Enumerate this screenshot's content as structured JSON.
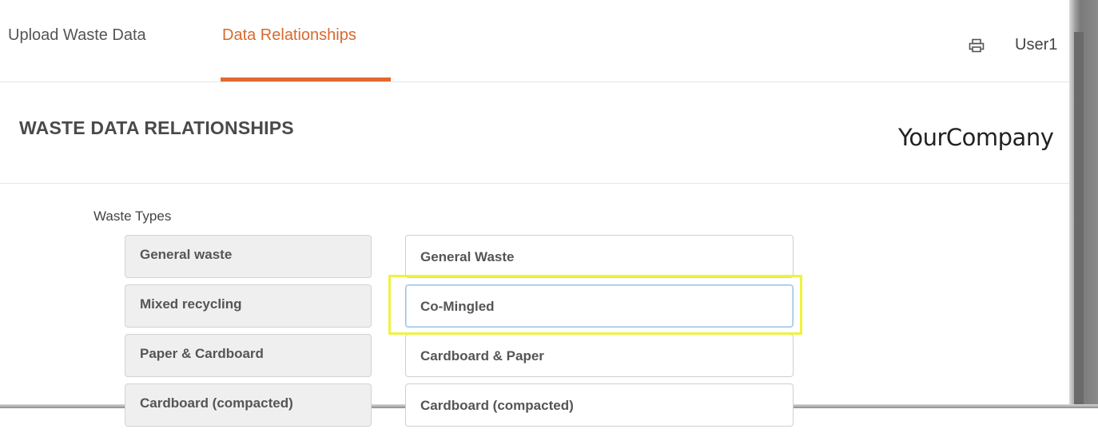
{
  "nav": {
    "tabs": [
      {
        "label": "Upload Waste Data",
        "active": false
      },
      {
        "label": "Data Relationships",
        "active": true
      }
    ],
    "user": "User1",
    "accent_color": "#e0692f"
  },
  "header": {
    "title": "WASTE DATA RELATIONSHIPS",
    "company": "YourCompany"
  },
  "mapping": {
    "label": "Waste Types",
    "source_items": [
      "General waste",
      "Mixed recycling",
      "Paper & Cardboard",
      "Cardboard (compacted)"
    ],
    "target_items": [
      "General Waste",
      "Co-Mingled",
      "Cardboard & Paper",
      "Cardboard (compacted)"
    ],
    "focused_index": 1,
    "highlight_color": "#eef33e"
  },
  "icons": {
    "print": "printer-icon"
  }
}
